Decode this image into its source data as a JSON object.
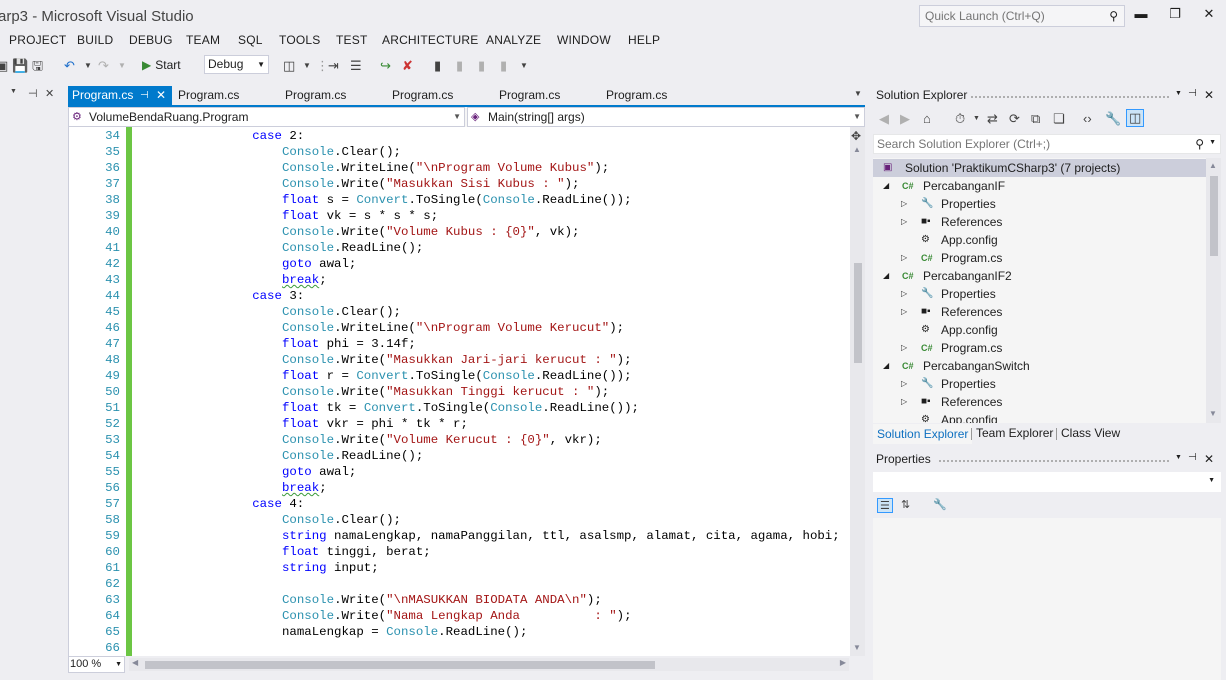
{
  "window": {
    "title": "arp3 - Microsoft Visual Studio",
    "quick_launch_placeholder": "Quick Launch (Ctrl+Q)",
    "minimize": "▬",
    "restore": "❐",
    "close": "✕"
  },
  "menu": [
    "PROJECT",
    "BUILD",
    "DEBUG",
    "TEAM",
    "SQL",
    "TOOLS",
    "TEST",
    "ARCHITECTURE",
    "ANALYZE",
    "WINDOW",
    "HELP"
  ],
  "toolbar": {
    "start_label": "Start",
    "config_value": "Debug"
  },
  "left_strip": {
    "pin": "⊣",
    "close": "✕"
  },
  "doc_tabs": [
    {
      "label": "Program.cs",
      "active": true
    },
    {
      "label": "Program.cs",
      "active": false
    },
    {
      "label": "Program.cs",
      "active": false
    },
    {
      "label": "Program.cs",
      "active": false
    },
    {
      "label": "Program.cs",
      "active": false
    },
    {
      "label": "Program.cs",
      "active": false
    }
  ],
  "navbar": {
    "type_value": "VolumeBendaRuang.Program",
    "member_value": "Main(string[] args)"
  },
  "editor": {
    "zoom": "100 %",
    "lines": [
      {
        "n": "34",
        "indent": 16,
        "tokens": [
          [
            "kw",
            "case"
          ],
          [
            "pl",
            " 2:"
          ]
        ]
      },
      {
        "n": "35",
        "indent": 20,
        "tokens": [
          [
            "ty",
            "Console"
          ],
          [
            "pl",
            ".Clear();"
          ]
        ]
      },
      {
        "n": "36",
        "indent": 20,
        "tokens": [
          [
            "ty",
            "Console"
          ],
          [
            "pl",
            ".WriteLine("
          ],
          [
            "st",
            "\"\\nProgram Volume Kubus\""
          ],
          [
            "pl",
            ");"
          ]
        ]
      },
      {
        "n": "37",
        "indent": 20,
        "tokens": [
          [
            "ty",
            "Console"
          ],
          [
            "pl",
            ".Write("
          ],
          [
            "st",
            "\"Masukkan Sisi Kubus : \""
          ],
          [
            "pl",
            ");"
          ]
        ]
      },
      {
        "n": "38",
        "indent": 20,
        "tokens": [
          [
            "kw",
            "float"
          ],
          [
            "pl",
            " s = "
          ],
          [
            "ty",
            "Convert"
          ],
          [
            "pl",
            ".ToSingle("
          ],
          [
            "ty",
            "Console"
          ],
          [
            "pl",
            ".ReadLine());"
          ]
        ]
      },
      {
        "n": "39",
        "indent": 20,
        "tokens": [
          [
            "kw",
            "float"
          ],
          [
            "pl",
            " vk = s * s * s;"
          ]
        ]
      },
      {
        "n": "40",
        "indent": 20,
        "tokens": [
          [
            "ty",
            "Console"
          ],
          [
            "pl",
            ".Write("
          ],
          [
            "st",
            "\"Volume Kubus : {0}\""
          ],
          [
            "pl",
            ", vk);"
          ]
        ]
      },
      {
        "n": "41",
        "indent": 20,
        "tokens": [
          [
            "ty",
            "Console"
          ],
          [
            "pl",
            ".ReadLine();"
          ]
        ]
      },
      {
        "n": "42",
        "indent": 20,
        "tokens": [
          [
            "kw",
            "goto"
          ],
          [
            "pl",
            " awal;"
          ]
        ]
      },
      {
        "n": "43",
        "indent": 20,
        "tokens": [
          [
            "kwsq",
            "break"
          ],
          [
            "pl",
            ";"
          ]
        ]
      },
      {
        "n": "44",
        "indent": 16,
        "tokens": [
          [
            "kw",
            "case"
          ],
          [
            "pl",
            " 3:"
          ]
        ]
      },
      {
        "n": "45",
        "indent": 20,
        "tokens": [
          [
            "ty",
            "Console"
          ],
          [
            "pl",
            ".Clear();"
          ]
        ]
      },
      {
        "n": "46",
        "indent": 20,
        "tokens": [
          [
            "ty",
            "Console"
          ],
          [
            "pl",
            ".WriteLine("
          ],
          [
            "st",
            "\"\\nProgram Volume Kerucut\""
          ],
          [
            "pl",
            ");"
          ]
        ]
      },
      {
        "n": "47",
        "indent": 20,
        "tokens": [
          [
            "kw",
            "float"
          ],
          [
            "pl",
            " phi = 3.14f;"
          ]
        ]
      },
      {
        "n": "48",
        "indent": 20,
        "tokens": [
          [
            "ty",
            "Console"
          ],
          [
            "pl",
            ".Write("
          ],
          [
            "st",
            "\"Masukkan Jari-jari kerucut : \""
          ],
          [
            "pl",
            ");"
          ]
        ]
      },
      {
        "n": "49",
        "indent": 20,
        "tokens": [
          [
            "kw",
            "float"
          ],
          [
            "pl",
            " r = "
          ],
          [
            "ty",
            "Convert"
          ],
          [
            "pl",
            ".ToSingle("
          ],
          [
            "ty",
            "Console"
          ],
          [
            "pl",
            ".ReadLine());"
          ]
        ]
      },
      {
        "n": "50",
        "indent": 20,
        "tokens": [
          [
            "ty",
            "Console"
          ],
          [
            "pl",
            ".Write("
          ],
          [
            "st",
            "\"Masukkan Tinggi kerucut : \""
          ],
          [
            "pl",
            ");"
          ]
        ]
      },
      {
        "n": "51",
        "indent": 20,
        "tokens": [
          [
            "kw",
            "float"
          ],
          [
            "pl",
            " tk = "
          ],
          [
            "ty",
            "Convert"
          ],
          [
            "pl",
            ".ToSingle("
          ],
          [
            "ty",
            "Console"
          ],
          [
            "pl",
            ".ReadLine());"
          ]
        ]
      },
      {
        "n": "52",
        "indent": 20,
        "tokens": [
          [
            "kw",
            "float"
          ],
          [
            "pl",
            " vkr = phi * tk * r;"
          ]
        ]
      },
      {
        "n": "53",
        "indent": 20,
        "tokens": [
          [
            "ty",
            "Console"
          ],
          [
            "pl",
            ".Write("
          ],
          [
            "st",
            "\"Volume Kerucut : {0}\""
          ],
          [
            "pl",
            ", vkr);"
          ]
        ]
      },
      {
        "n": "54",
        "indent": 20,
        "tokens": [
          [
            "ty",
            "Console"
          ],
          [
            "pl",
            ".ReadLine();"
          ]
        ]
      },
      {
        "n": "55",
        "indent": 20,
        "tokens": [
          [
            "kw",
            "goto"
          ],
          [
            "pl",
            " awal;"
          ]
        ]
      },
      {
        "n": "56",
        "indent": 20,
        "tokens": [
          [
            "kwsq",
            "break"
          ],
          [
            "pl",
            ";"
          ]
        ]
      },
      {
        "n": "57",
        "indent": 16,
        "tokens": [
          [
            "kw",
            "case"
          ],
          [
            "pl",
            " 4:"
          ]
        ]
      },
      {
        "n": "58",
        "indent": 20,
        "tokens": [
          [
            "ty",
            "Console"
          ],
          [
            "pl",
            ".Clear();"
          ]
        ]
      },
      {
        "n": "59",
        "indent": 20,
        "tokens": [
          [
            "kw",
            "string"
          ],
          [
            "pl",
            " namaLengkap, namaPanggilan, ttl, asalsmp, alamat, cita, agama, hobi;"
          ]
        ]
      },
      {
        "n": "60",
        "indent": 20,
        "tokens": [
          [
            "kw",
            "float"
          ],
          [
            "pl",
            " tinggi, berat;"
          ]
        ]
      },
      {
        "n": "61",
        "indent": 20,
        "tokens": [
          [
            "kw",
            "string"
          ],
          [
            "pl",
            " input;"
          ]
        ]
      },
      {
        "n": "62",
        "indent": 0,
        "tokens": []
      },
      {
        "n": "63",
        "indent": 20,
        "tokens": [
          [
            "ty",
            "Console"
          ],
          [
            "pl",
            ".Write("
          ],
          [
            "st",
            "\"\\nMASUKKAN BIODATA ANDA\\n\""
          ],
          [
            "pl",
            ");"
          ]
        ]
      },
      {
        "n": "64",
        "indent": 20,
        "tokens": [
          [
            "ty",
            "Console"
          ],
          [
            "pl",
            ".Write("
          ],
          [
            "st",
            "\"Nama Lengkap Anda          : \""
          ],
          [
            "pl",
            ");"
          ]
        ]
      },
      {
        "n": "65",
        "indent": 20,
        "tokens": [
          [
            "pl",
            "namaLengkap = "
          ],
          [
            "ty",
            "Console"
          ],
          [
            "pl",
            ".ReadLine();"
          ]
        ]
      },
      {
        "n": "66",
        "indent": 0,
        "tokens": []
      }
    ]
  },
  "solution_explorer": {
    "title": "Solution Explorer",
    "search_placeholder": "Search Solution Explorer (Ctrl+;)",
    "tree": [
      {
        "level": 0,
        "exp": "",
        "icon": "solution-icon",
        "glyph": "▣",
        "label": "Solution 'PraktikumCSharp3' (7 projects)",
        "selected": true
      },
      {
        "level": 1,
        "exp": "◢",
        "icon": "csharp-project-icon",
        "glyph": "C#",
        "label": "PercabanganIF"
      },
      {
        "level": 2,
        "exp": "▷",
        "icon": "wrench-icon",
        "glyph": "🔧",
        "label": "Properties"
      },
      {
        "level": 2,
        "exp": "▷",
        "icon": "references-icon",
        "glyph": "■▪",
        "label": "References"
      },
      {
        "level": 2,
        "exp": "",
        "icon": "config-icon",
        "glyph": "⚙",
        "label": "App.config"
      },
      {
        "level": 2,
        "exp": "▷",
        "icon": "csharp-file-icon",
        "glyph": "C#",
        "label": "Program.cs"
      },
      {
        "level": 1,
        "exp": "◢",
        "icon": "csharp-project-icon",
        "glyph": "C#",
        "label": "PercabanganIF2"
      },
      {
        "level": 2,
        "exp": "▷",
        "icon": "wrench-icon",
        "glyph": "🔧",
        "label": "Properties"
      },
      {
        "level": 2,
        "exp": "▷",
        "icon": "references-icon",
        "glyph": "■▪",
        "label": "References"
      },
      {
        "level": 2,
        "exp": "",
        "icon": "config-icon",
        "glyph": "⚙",
        "label": "App.config"
      },
      {
        "level": 2,
        "exp": "▷",
        "icon": "csharp-file-icon",
        "glyph": "C#",
        "label": "Program.cs"
      },
      {
        "level": 1,
        "exp": "◢",
        "icon": "csharp-project-icon",
        "glyph": "C#",
        "label": "PercabanganSwitch"
      },
      {
        "level": 2,
        "exp": "▷",
        "icon": "wrench-icon",
        "glyph": "🔧",
        "label": "Properties"
      },
      {
        "level": 2,
        "exp": "▷",
        "icon": "references-icon",
        "glyph": "■▪",
        "label": "References"
      },
      {
        "level": 2,
        "exp": "",
        "icon": "config-icon",
        "glyph": "⚙",
        "label": "App.config"
      }
    ],
    "tabs": [
      "Solution Explorer",
      "Team Explorer",
      "Class View"
    ]
  },
  "properties": {
    "title": "Properties"
  },
  "colors": {
    "accent": "#007acc",
    "keyword": "#0000ff",
    "type": "#2b91af",
    "string": "#a31515",
    "change_bar": "#6cc644"
  }
}
